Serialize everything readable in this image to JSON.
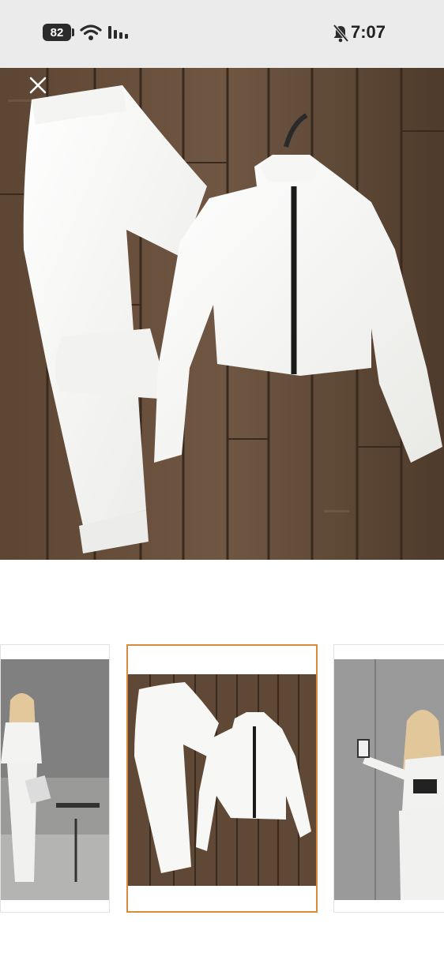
{
  "status_bar": {
    "battery_level": "82",
    "time": "7:07",
    "icons": [
      "battery-icon",
      "wifi-icon",
      "cellular-signal-icon",
      "bell-muted-icon"
    ]
  },
  "viewer": {
    "close_icon": "close-icon",
    "main_image": "white-zip-jacket-and-jogger-set-on-wood-floor",
    "thumbnails": [
      {
        "name": "model-wearing-white-set-front",
        "selected": false
      },
      {
        "name": "white-set-flat-lay-on-wood",
        "selected": true
      },
      {
        "name": "model-wearing-white-set-side",
        "selected": false
      }
    ],
    "selected_border_color": "#d98a3a"
  }
}
